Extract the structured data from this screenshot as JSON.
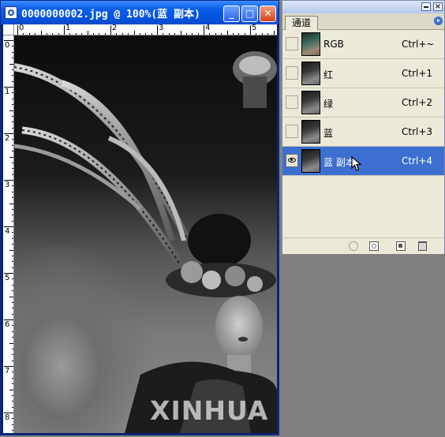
{
  "document": {
    "title": "0000000002.jpg @ 100%(蓝 副本)",
    "ruler_top_labels": [
      "0",
      "1",
      "2",
      "3",
      "4",
      "5"
    ],
    "ruler_left_labels": [
      "0",
      "1",
      "2",
      "3",
      "4",
      "5",
      "6",
      "7",
      "8"
    ],
    "watermark": "XINHUA",
    "window_buttons": {
      "minimize": "_",
      "maximize": "□",
      "close": "✕"
    }
  },
  "palette": {
    "tab_label": "通道",
    "channels": [
      {
        "name": "RGB",
        "shortcut": "Ctrl+~",
        "visible": false,
        "selected": false,
        "thumb": "rgb"
      },
      {
        "name": "红",
        "shortcut": "Ctrl+1",
        "visible": false,
        "selected": false,
        "thumb": "gray"
      },
      {
        "name": "绿",
        "shortcut": "Ctrl+2",
        "visible": false,
        "selected": false,
        "thumb": "gray"
      },
      {
        "name": "蓝",
        "shortcut": "Ctrl+3",
        "visible": false,
        "selected": false,
        "thumb": "gray"
      },
      {
        "name": "蓝 副本",
        "shortcut": "Ctrl+4",
        "visible": true,
        "selected": true,
        "thumb": "gray"
      }
    ],
    "footer_icons": [
      "load-selection-icon",
      "save-selection-icon",
      "new-channel-icon",
      "delete-channel-icon"
    ]
  },
  "colors": {
    "titlebar": "#0554e0",
    "selection": "#3c6fcf",
    "workspace": "#808080",
    "palette_bg": "#ece9d8"
  }
}
